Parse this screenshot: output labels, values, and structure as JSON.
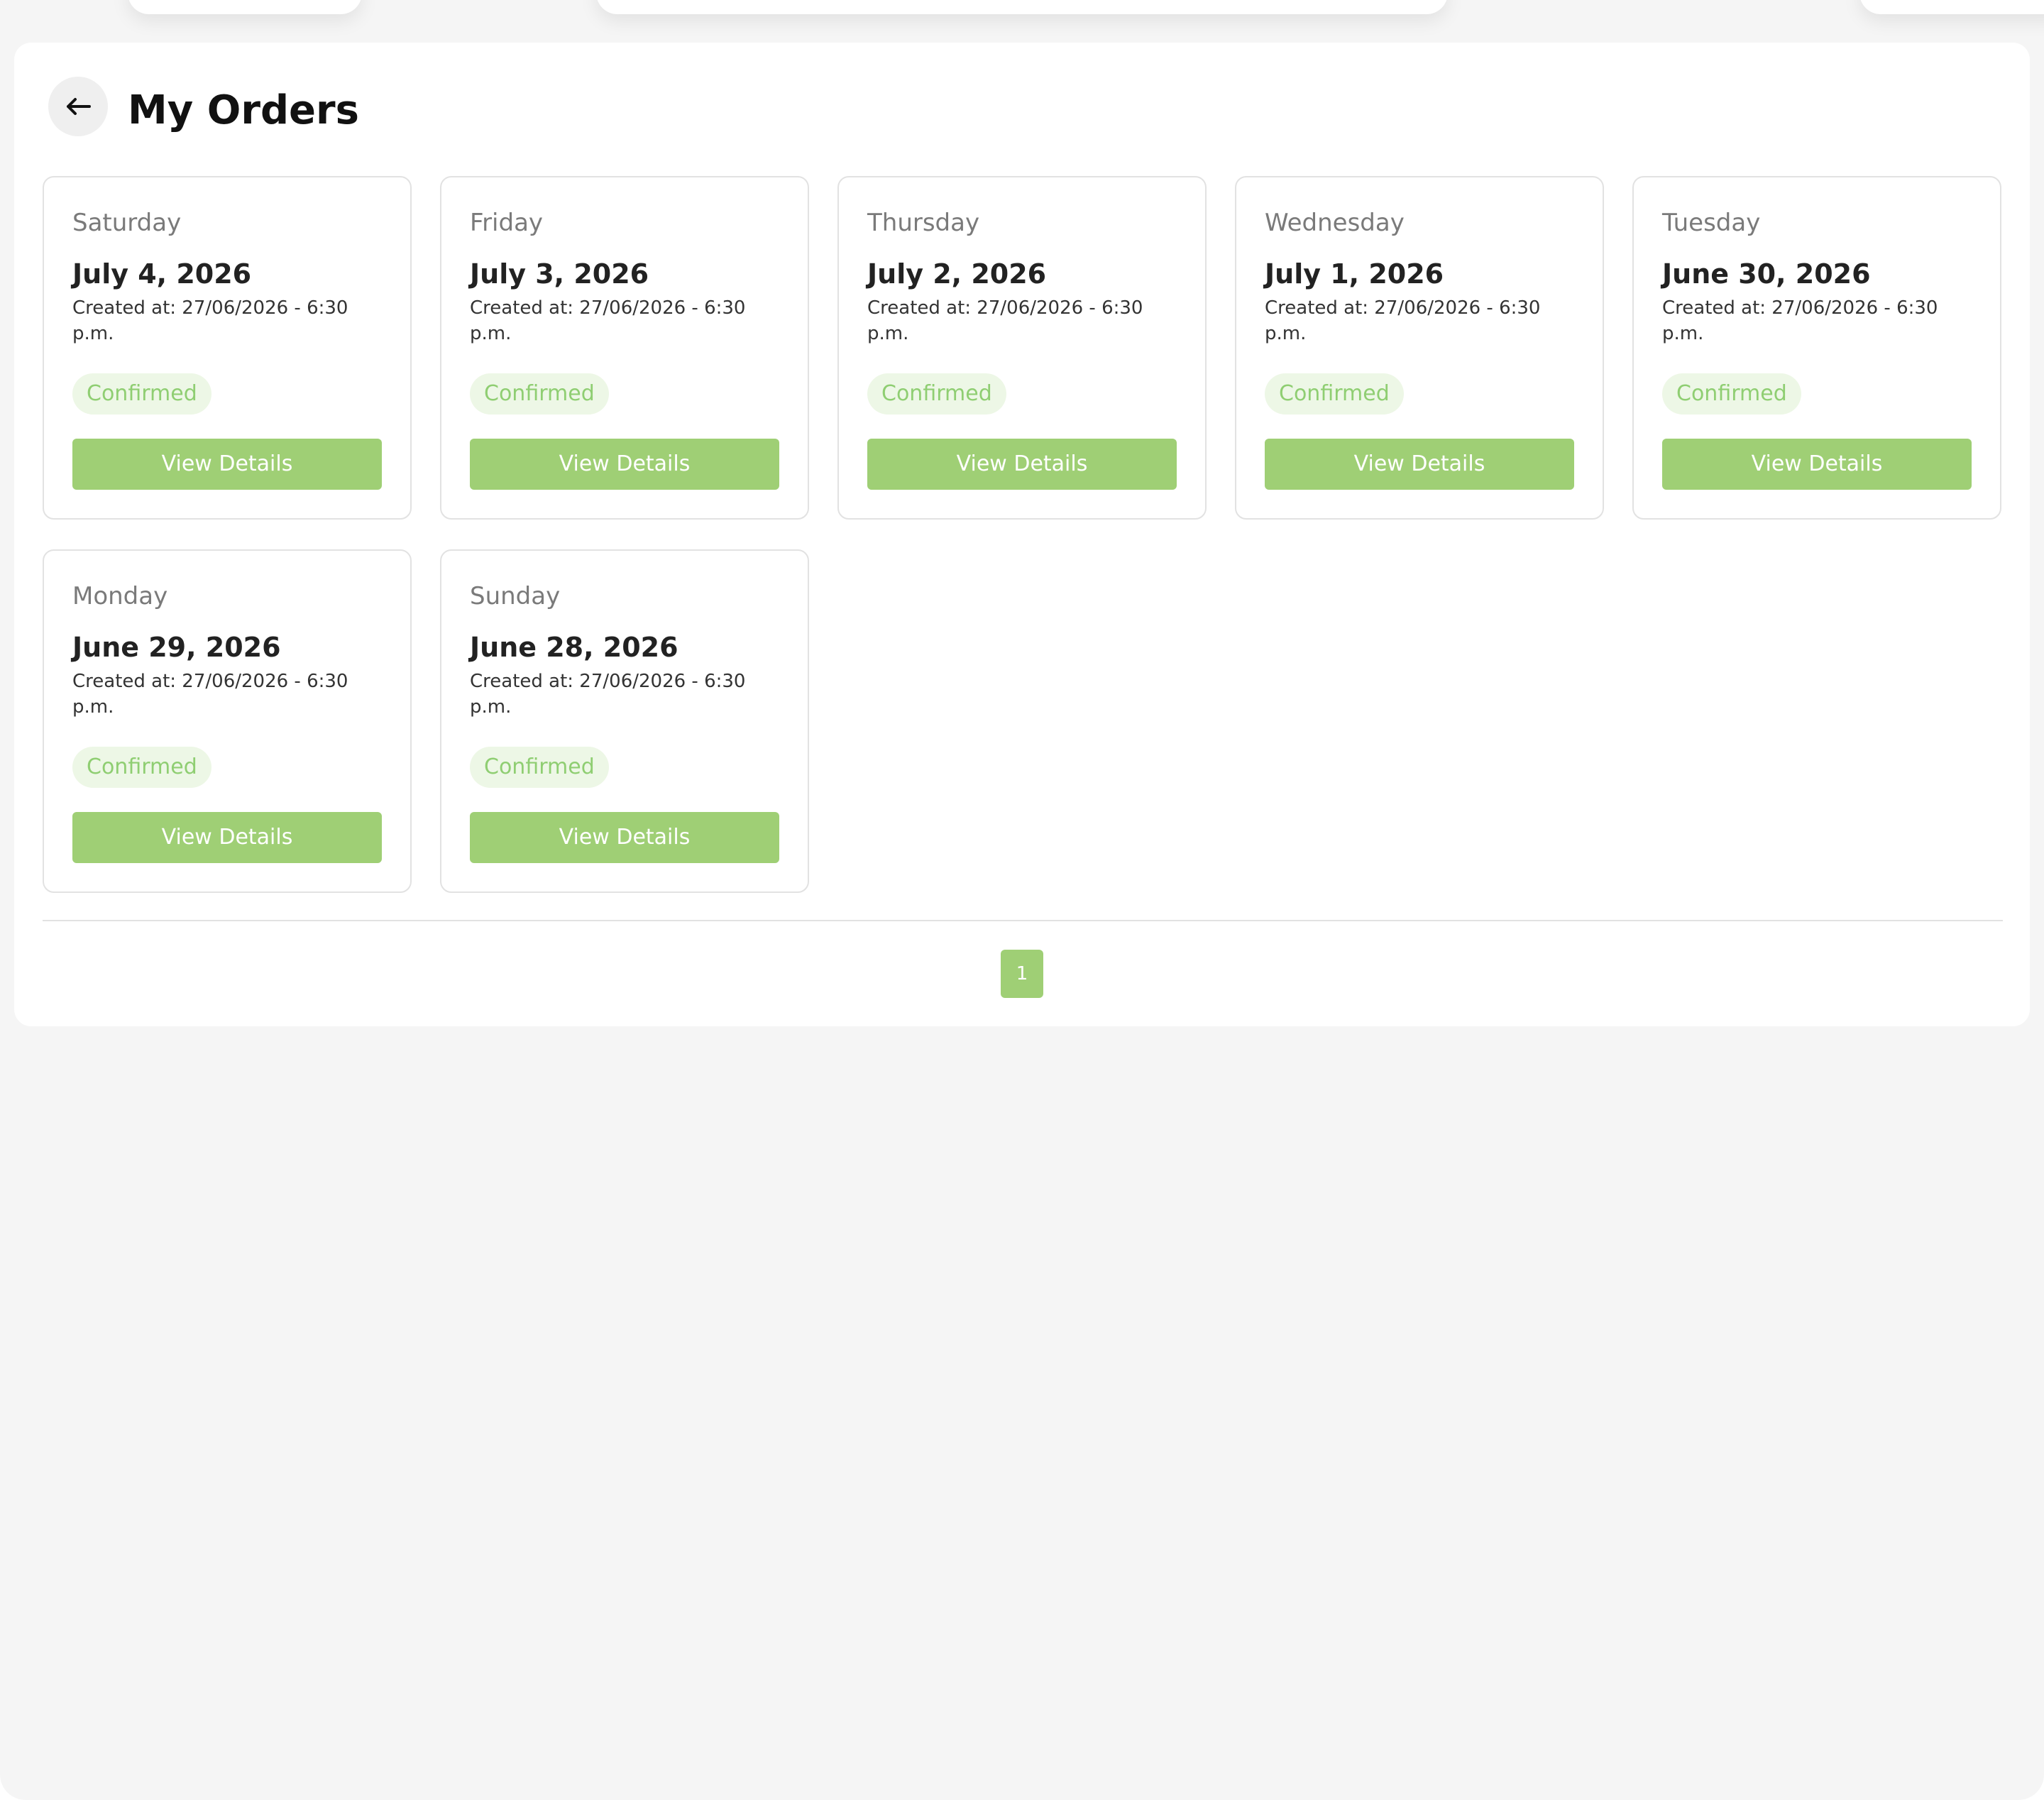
{
  "header": {
    "title": "My Orders",
    "back_icon": "arrow-left-icon"
  },
  "orders": [
    {
      "weekday": "Saturday",
      "date": "July 4, 2026",
      "created": "Created at: 27/06/2026 - 6:30 p.m.",
      "status": "Confirmed",
      "action": "View Details"
    },
    {
      "weekday": "Friday",
      "date": "July 3, 2026",
      "created": "Created at: 27/06/2026 - 6:30 p.m.",
      "status": "Confirmed",
      "action": "View Details"
    },
    {
      "weekday": "Thursday",
      "date": "July 2, 2026",
      "created": "Created at: 27/06/2026 - 6:30 p.m.",
      "status": "Confirmed",
      "action": "View Details"
    },
    {
      "weekday": "Wednesday",
      "date": "July 1, 2026",
      "created": "Created at: 27/06/2026 - 6:30 p.m.",
      "status": "Confirmed",
      "action": "View Details"
    },
    {
      "weekday": "Tuesday",
      "date": "June 30, 2026",
      "created": "Created at: 27/06/2026 - 6:30 p.m.",
      "status": "Confirmed",
      "action": "View Details"
    },
    {
      "weekday": "Monday",
      "date": "June 29, 2026",
      "created": "Created at: 27/06/2026 - 6:30 p.m.",
      "status": "Confirmed",
      "action": "View Details"
    },
    {
      "weekday": "Sunday",
      "date": "June 28, 2026",
      "created": "Created at: 27/06/2026 - 6:30 p.m.",
      "status": "Confirmed",
      "action": "View Details"
    }
  ],
  "pagination": {
    "pages": [
      "1"
    ],
    "current": "1"
  },
  "colors": {
    "accent": "#9fcf75",
    "status_text": "#8fce72",
    "status_bg": "#edf7e6",
    "page_bg": "#f5f5f5"
  }
}
